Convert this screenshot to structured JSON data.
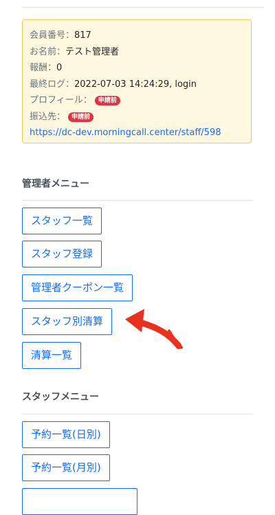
{
  "member_info": {
    "member_number_label": "会員番号：",
    "member_number": "817",
    "name_label": "お名前：",
    "name": "テスト管理者",
    "reward_label": "報酬：",
    "reward": "0",
    "last_log_label": "最終ログ：",
    "last_log": "2022-07-03 14:24:29, login",
    "profile_label": "プロフィール：",
    "profile_status": "申請前",
    "transfer_label": "振込先：",
    "transfer_status": "申請前",
    "staff_url": "https://dc-dev.morningcall.center/staff/598",
    "badge_color": "#dc3545"
  },
  "admin_menu": {
    "title": "管理者メニュー",
    "items": [
      "スタッフ一覧",
      "スタッフ登録",
      "管理者クーポン一覧",
      "スタッフ別清算",
      "清算一覧"
    ]
  },
  "staff_menu": {
    "title": "スタッフメニュー",
    "items": [
      "予約一覧(日別)",
      "予約一覧(月別)"
    ]
  },
  "annotation": {
    "icon": "red-arrow-icon",
    "color": "#e8321e"
  },
  "colors": {
    "primary": "#0d6efd",
    "card_border": "#f2c94c",
    "card_bg": "#fff8e1"
  }
}
